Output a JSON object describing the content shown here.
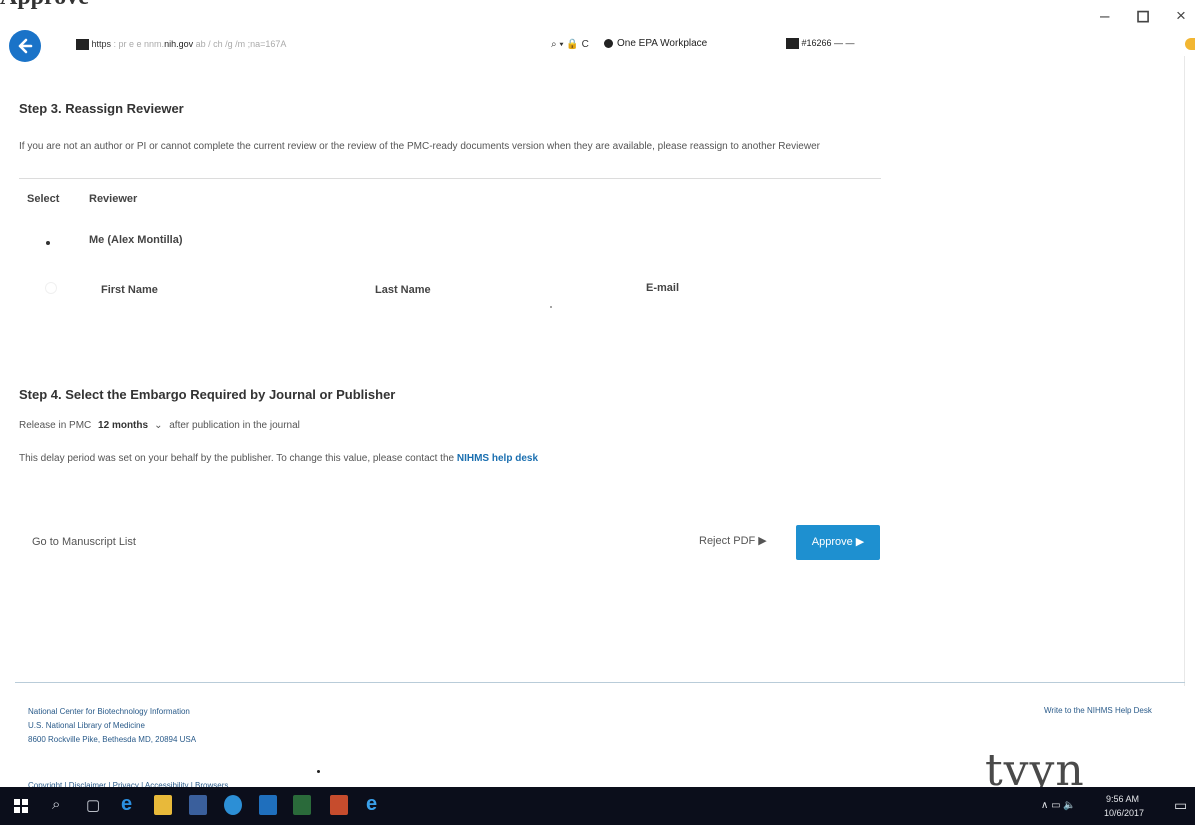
{
  "window": {
    "title_cut": "Approve",
    "controls": {
      "minimize": "–",
      "maximize": "◻",
      "close": "×"
    }
  },
  "addressbar": {
    "url_scheme": "https",
    "url_pre": "  :  pr  e   e     nnm.",
    "url_domain": "nih.gov",
    "url_post": "  ab  /  ch  /g  /m  ;na=167A",
    "tools": "⌕ ▾  🔒 C",
    "tab_label": "One EPA Workplace",
    "tab2_label": "#16266 — —"
  },
  "step3": {
    "title": "Step 3. Reassign Reviewer",
    "desc": "If you are not an author or PI or cannot complete the current review or the review of the PMC-ready documents version when they are available, please reassign to another Reviewer",
    "col_select": "Select",
    "col_reviewer": "Reviewer",
    "me_label": "Me (Alex Montilla)",
    "first_name": "First Name",
    "last_name": "Last Name",
    "email": "E-mail"
  },
  "step4": {
    "title": "Step 4. Select the Embargo Required by Journal or Publisher",
    "release_prefix": "Release in PMC",
    "release_value": "12 months",
    "release_suffix": "after publication in the journal",
    "delay_text": "This delay period was set on your behalf by the publisher. To change this value, please contact the",
    "help_link": "NIHMS help desk"
  },
  "actions": {
    "goto_list": "Go to Manuscript List",
    "reject": "Reject PDF ▶",
    "approve": "Approve ▶"
  },
  "footer": {
    "line1": "National Center for Biotechnology Information",
    "line2": "U.S. National Library of Medicine",
    "line3": "8600 Rockville Pike, Bethesda MD, 20894 USA",
    "links": "Copyright | Disclaimer | Privacy | Accessibility | Browsers",
    "helpdesk": "Write to the NIHMS Help Desk",
    "watermark": "tvyn"
  },
  "taskbar": {
    "time": "9:56 AM",
    "date": "10/6/2017",
    "tray_icons": "∧ ▭ 🔈"
  },
  "colors": {
    "accent": "#1e90d0",
    "link": "#1a6fb0",
    "taskbar_bg": "#0b0e1b"
  }
}
